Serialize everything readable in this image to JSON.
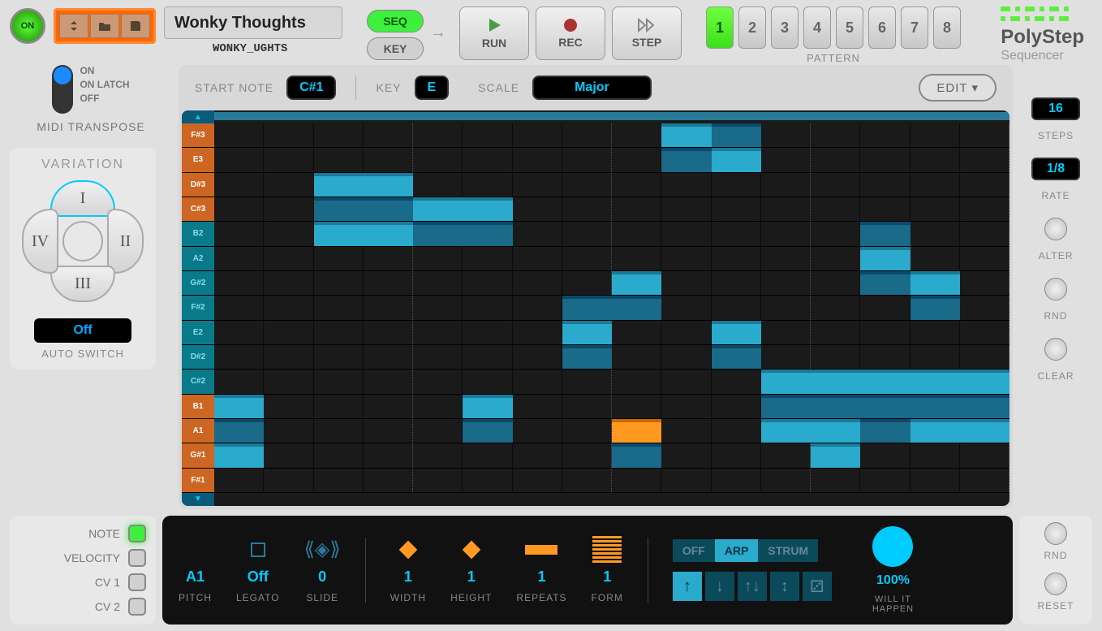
{
  "power": "ON",
  "patch": {
    "name": "Wonky Thoughts",
    "sub": "WONKY_UGHTS"
  },
  "modes": {
    "seq": "SEQ",
    "key": "KEY"
  },
  "transport": {
    "run": "RUN",
    "rec": "REC",
    "step": "STEP"
  },
  "patterns": {
    "label": "PATTERN",
    "items": [
      "1",
      "2",
      "3",
      "4",
      "5",
      "6",
      "7",
      "8"
    ],
    "active": 0
  },
  "logo": {
    "main": "PolyStep",
    "sub": "Sequencer"
  },
  "midi": {
    "title": "MIDI TRANSPOSE",
    "opts": [
      "ON",
      "ON LATCH",
      "OFF"
    ]
  },
  "variation": {
    "title": "VARIATION",
    "segs": [
      "I",
      "II",
      "III",
      "IV"
    ],
    "auto_val": "Off",
    "auto_label": "AUTO SWITCH"
  },
  "params": {
    "start_note_label": "START NOTE",
    "start_note": "C#1",
    "key_label": "KEY",
    "key": "E",
    "scale_label": "SCALE",
    "scale": "Major",
    "edit": "EDIT ▾"
  },
  "note_rows": [
    "F#3",
    "E3",
    "D#3",
    "C#3",
    "B2",
    "A2",
    "G#2",
    "F#2",
    "E2",
    "D#2",
    "C#2",
    "B1",
    "A1",
    "G#1",
    "F#1"
  ],
  "row_colors": [
    "orange",
    "orange",
    "orange",
    "orange",
    "teal",
    "teal",
    "teal",
    "teal",
    "teal",
    "teal",
    "teal",
    "orange",
    "orange",
    "orange",
    "orange"
  ],
  "notes": [
    {
      "row": 0,
      "col": 9,
      "w": 1
    },
    {
      "row": 0,
      "col": 10,
      "w": 1,
      "dark": true
    },
    {
      "row": 1,
      "col": 9,
      "w": 1,
      "dark": true
    },
    {
      "row": 1,
      "col": 10,
      "w": 1
    },
    {
      "row": 2,
      "col": 2,
      "w": 2
    },
    {
      "row": 3,
      "col": 2,
      "w": 2,
      "dark": true
    },
    {
      "row": 3,
      "col": 4,
      "w": 2
    },
    {
      "row": 4,
      "col": 2,
      "w": 2
    },
    {
      "row": 4,
      "col": 4,
      "w": 2,
      "dark": true
    },
    {
      "row": 4,
      "col": 13,
      "w": 1,
      "dark": true
    },
    {
      "row": 5,
      "col": 13,
      "w": 1
    },
    {
      "row": 6,
      "col": 8,
      "w": 1
    },
    {
      "row": 6,
      "col": 13,
      "w": 1,
      "dark": true
    },
    {
      "row": 6,
      "col": 14,
      "w": 1
    },
    {
      "row": 7,
      "col": 7,
      "w": 1,
      "dark": true
    },
    {
      "row": 7,
      "col": 8,
      "w": 1,
      "dark": true
    },
    {
      "row": 7,
      "col": 14,
      "w": 1,
      "dark": true
    },
    {
      "row": 8,
      "col": 7,
      "w": 1
    },
    {
      "row": 8,
      "col": 10,
      "w": 1
    },
    {
      "row": 9,
      "col": 7,
      "w": 1,
      "dark": true
    },
    {
      "row": 9,
      "col": 10,
      "w": 1,
      "dark": true
    },
    {
      "row": 10,
      "col": 11,
      "w": 3
    },
    {
      "row": 10,
      "col": 14,
      "w": 2
    },
    {
      "row": 11,
      "col": 0,
      "w": 1
    },
    {
      "row": 11,
      "col": 5,
      "w": 1
    },
    {
      "row": 11,
      "col": 11,
      "w": 3,
      "dark": true
    },
    {
      "row": 11,
      "col": 14,
      "w": 2,
      "dark": true
    },
    {
      "row": 12,
      "col": 0,
      "w": 1,
      "dark": true
    },
    {
      "row": 12,
      "col": 5,
      "w": 1,
      "dark": true
    },
    {
      "row": 12,
      "col": 8,
      "w": 1,
      "orange": true
    },
    {
      "row": 12,
      "col": 11,
      "w": 2
    },
    {
      "row": 12,
      "col": 13,
      "w": 1,
      "dark": true
    },
    {
      "row": 12,
      "col": 14,
      "w": 2
    },
    {
      "row": 13,
      "col": 0,
      "w": 1
    },
    {
      "row": 13,
      "col": 8,
      "w": 1,
      "dark": true
    },
    {
      "row": 13,
      "col": 12,
      "w": 1
    }
  ],
  "right": {
    "steps_val": "16",
    "steps": "STEPS",
    "rate_val": "1/8",
    "rate": "RATE",
    "alter": "ALTER",
    "rnd": "RND",
    "clear": "CLEAR"
  },
  "views": {
    "note": "NOTE",
    "velocity": "VELOCITY",
    "cv1": "CV 1",
    "cv2": "CV 2"
  },
  "note_params": {
    "pitch_val": "A1",
    "pitch": "PITCH",
    "legato_val": "Off",
    "legato": "LEGATO",
    "slide_val": "0",
    "slide": "SLIDE",
    "width_val": "1",
    "width": "WIDTH",
    "height_val": "1",
    "height": "HEIGHT",
    "repeats_val": "1",
    "repeats": "REPEATS",
    "form_val": "1",
    "form": "FORM"
  },
  "play_modes": {
    "off": "OFF",
    "arp": "ARP",
    "strum": "STRUM"
  },
  "prob": {
    "val": "100%",
    "label1": "WILL IT",
    "label2": "HAPPEN"
  },
  "actions": {
    "rnd": "RND",
    "reset": "RESET"
  }
}
